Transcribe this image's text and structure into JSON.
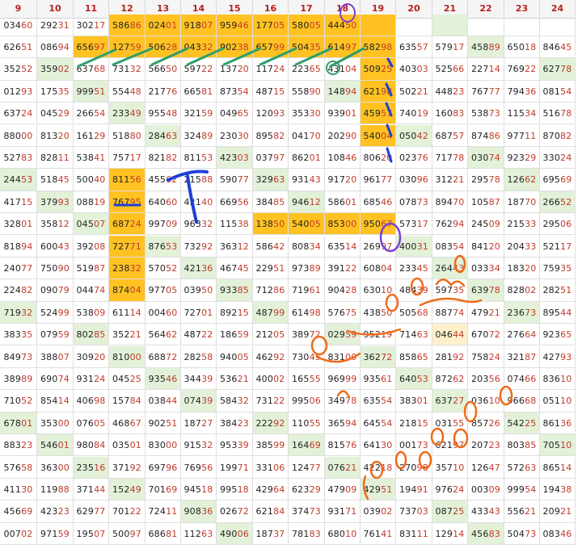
{
  "columns": [
    "9",
    "10",
    "11",
    "12",
    "13",
    "14",
    "15",
    "16",
    "17",
    "18",
    "19",
    "20",
    "21",
    "22",
    "23",
    "24"
  ],
  "rows": [
    [
      "03460",
      "29231",
      "30217",
      "58686",
      "02401",
      "91807",
      "95946",
      "17705",
      "58005",
      "44450",
      "",
      "",
      "",
      "",
      "",
      ""
    ],
    [
      "62651",
      "08694",
      "65697",
      "12759",
      "50628",
      "04332",
      "90238",
      "65799",
      "50435",
      "61497",
      "58298",
      "63557",
      "57917",
      "45889",
      "65018",
      "84645"
    ],
    [
      "35252",
      "35902",
      "63768",
      "73132",
      "56650",
      "59722",
      "13720",
      "11724",
      "22365",
      "43104",
      "50925",
      "40303",
      "52566",
      "22714",
      "76922",
      "62778"
    ],
    [
      "01293",
      "17535",
      "99951",
      "55448",
      "21776",
      "66581",
      "87354",
      "48715",
      "55890",
      "14894",
      "62198",
      "50221",
      "44823",
      "76777",
      "79436",
      "08154"
    ],
    [
      "63724",
      "04529",
      "26654",
      "23349",
      "95548",
      "32159",
      "04965",
      "12093",
      "35330",
      "93901",
      "45957",
      "74019",
      "16083",
      "53873",
      "11534",
      "51678"
    ],
    [
      "88000",
      "81320",
      "16129",
      "51880",
      "28463",
      "32489",
      "23030",
      "89582",
      "04170",
      "20290",
      "54004",
      "05042",
      "68757",
      "87486",
      "97711",
      "87082"
    ],
    [
      "52783",
      "82811",
      "53841",
      "75717",
      "82182",
      "81153",
      "42303",
      "03797",
      "86201",
      "10846",
      "80620",
      "02376",
      "71778",
      "03074",
      "92329",
      "33024"
    ],
    [
      "24453",
      "51845",
      "50040",
      "81156",
      "45562",
      "21588",
      "59077",
      "32963",
      "93143",
      "91720",
      "96177",
      "03096",
      "31221",
      "29578",
      "12662",
      "69569"
    ],
    [
      "41715",
      "37993",
      "08819",
      "76795",
      "64060",
      "42140",
      "66956",
      "38485",
      "94612",
      "58601",
      "68546",
      "07873",
      "89470",
      "10587",
      "18770",
      "26652"
    ],
    [
      "32801",
      "35812",
      "04507",
      "68724",
      "99709",
      "96332",
      "11538",
      "13850",
      "54005",
      "85300",
      "95067",
      "57317",
      "76294",
      "24509",
      "21533",
      "29506"
    ],
    [
      "81894",
      "60043",
      "39208",
      "72771",
      "87653",
      "73292",
      "36312",
      "58642",
      "80834",
      "63514",
      "26997",
      "40031",
      "08354",
      "84120",
      "20433",
      "52117"
    ],
    [
      "24077",
      "75090",
      "51987",
      "23832",
      "57052",
      "42136",
      "46745",
      "22951",
      "97389",
      "39122",
      "60804",
      "23345",
      "26443",
      "03334",
      "18320",
      "75935"
    ],
    [
      "22482",
      "09079",
      "04474",
      "87404",
      "97705",
      "03950",
      "93385",
      "71286",
      "71961",
      "90428",
      "63010",
      "48439",
      "59735",
      "63978",
      "82802",
      "28251"
    ],
    [
      "71932",
      "52499",
      "53809",
      "61114",
      "00460",
      "72701",
      "89215",
      "48799",
      "61498",
      "57675",
      "43850",
      "50568",
      "88774",
      "47921",
      "23673",
      "89544"
    ],
    [
      "38335",
      "07959",
      "80285",
      "35221",
      "56462",
      "48722",
      "18659",
      "21205",
      "38972",
      "02959",
      "95219",
      "71463",
      "04644",
      "67072",
      "27664",
      "92365"
    ],
    [
      "84973",
      "38807",
      "30920",
      "81000",
      "68872",
      "28258",
      "94005",
      "46292",
      "73045",
      "83100",
      "36272",
      "85865",
      "28192",
      "75824",
      "32187",
      "42793"
    ],
    [
      "38989",
      "69074",
      "93124",
      "04525",
      "93546",
      "34439",
      "53621",
      "40002",
      "16555",
      "96999",
      "93561",
      "64053",
      "87262",
      "20356",
      "07466",
      "83610"
    ],
    [
      "71052",
      "85414",
      "40698",
      "15784",
      "03844",
      "07439",
      "58432",
      "73122",
      "99506",
      "34978",
      "63554",
      "38301",
      "63727",
      "03610",
      "96668",
      "05110"
    ],
    [
      "67801",
      "35300",
      "07605",
      "46867",
      "90251",
      "18727",
      "38423",
      "22292",
      "11055",
      "36594",
      "64554",
      "21815",
      "03155",
      "85726",
      "54225",
      "86136"
    ],
    [
      "88323",
      "54601",
      "98084",
      "03501",
      "83000",
      "91532",
      "95339",
      "38599",
      "16469",
      "81576",
      "64130",
      "00173",
      "62197",
      "20723",
      "80385",
      "70510"
    ],
    [
      "57658",
      "36300",
      "23516",
      "37192",
      "69796",
      "76956",
      "19971",
      "33106",
      "12477",
      "07621",
      "42218",
      "27098",
      "35710",
      "12647",
      "57263",
      "86514"
    ],
    [
      "41130",
      "11988",
      "37144",
      "15249",
      "70169",
      "94518",
      "99518",
      "42964",
      "62329",
      "47909",
      "42951",
      "19491",
      "97624",
      "00309",
      "99954",
      "19438"
    ],
    [
      "45669",
      "42323",
      "62977",
      "70122",
      "72411",
      "90836",
      "02672",
      "62184",
      "37473",
      "93171",
      "03902",
      "73703",
      "08725",
      "43343",
      "55621",
      "20921"
    ],
    [
      "00702",
      "97159",
      "19507",
      "50097",
      "68681",
      "11263",
      "49006",
      "18737",
      "78183",
      "68010",
      "76141",
      "83111",
      "12914",
      "45683",
      "50473",
      "08346"
    ]
  ],
  "highlight_cells": [
    [
      0,
      3
    ],
    [
      0,
      4
    ],
    [
      0,
      5
    ],
    [
      0,
      6
    ],
    [
      0,
      7
    ],
    [
      0,
      8
    ],
    [
      0,
      9
    ],
    [
      0,
      10
    ],
    [
      1,
      2
    ],
    [
      1,
      3
    ],
    [
      1,
      4
    ],
    [
      1,
      5
    ],
    [
      1,
      6
    ],
    [
      1,
      7
    ],
    [
      1,
      8
    ],
    [
      1,
      9
    ],
    [
      1,
      10
    ],
    [
      2,
      10
    ],
    [
      3,
      10
    ],
    [
      4,
      10
    ],
    [
      5,
      10
    ],
    [
      7,
      3
    ],
    [
      8,
      3
    ],
    [
      9,
      3
    ],
    [
      10,
      3
    ],
    [
      11,
      3
    ],
    [
      12,
      3
    ],
    [
      9,
      7
    ],
    [
      9,
      8
    ],
    [
      9,
      9
    ],
    [
      9,
      10
    ]
  ],
  "green_cells": [
    [
      0,
      12
    ],
    [
      1,
      13
    ],
    [
      2,
      1
    ],
    [
      2,
      15
    ],
    [
      3,
      2
    ],
    [
      3,
      9
    ],
    [
      4,
      3
    ],
    [
      5,
      4
    ],
    [
      5,
      11
    ],
    [
      6,
      6
    ],
    [
      6,
      13
    ],
    [
      7,
      0
    ],
    [
      7,
      7
    ],
    [
      7,
      14
    ],
    [
      8,
      1
    ],
    [
      8,
      8
    ],
    [
      8,
      15
    ],
    [
      9,
      2
    ],
    [
      10,
      4
    ],
    [
      10,
      11
    ],
    [
      11,
      5
    ],
    [
      11,
      12
    ],
    [
      12,
      6
    ],
    [
      12,
      13
    ],
    [
      13,
      0
    ],
    [
      13,
      7
    ],
    [
      13,
      14
    ],
    [
      14,
      2
    ],
    [
      14,
      9
    ],
    [
      15,
      3
    ],
    [
      15,
      10
    ],
    [
      16,
      4
    ],
    [
      16,
      11
    ],
    [
      17,
      5
    ],
    [
      17,
      12
    ],
    [
      18,
      0
    ],
    [
      18,
      7
    ],
    [
      18,
      14
    ],
    [
      19,
      1
    ],
    [
      19,
      8
    ],
    [
      19,
      15
    ],
    [
      20,
      2
    ],
    [
      20,
      9
    ],
    [
      21,
      3
    ],
    [
      21,
      10
    ],
    [
      22,
      5
    ],
    [
      22,
      12
    ],
    [
      23,
      6
    ],
    [
      23,
      13
    ]
  ],
  "light_cells": [
    [
      14,
      12
    ]
  ],
  "colors": {
    "highlight": "#ffc222",
    "green": "#e2f1d8",
    "light": "#fff0cc",
    "header_text": "#b72020",
    "digit_tail": "#c23a2a",
    "annotation_green": "#2e9e6b",
    "annotation_blue": "#1f3fd6",
    "annotation_orange": "#ef6a1a",
    "annotation_purple": "#7b3fd6"
  }
}
